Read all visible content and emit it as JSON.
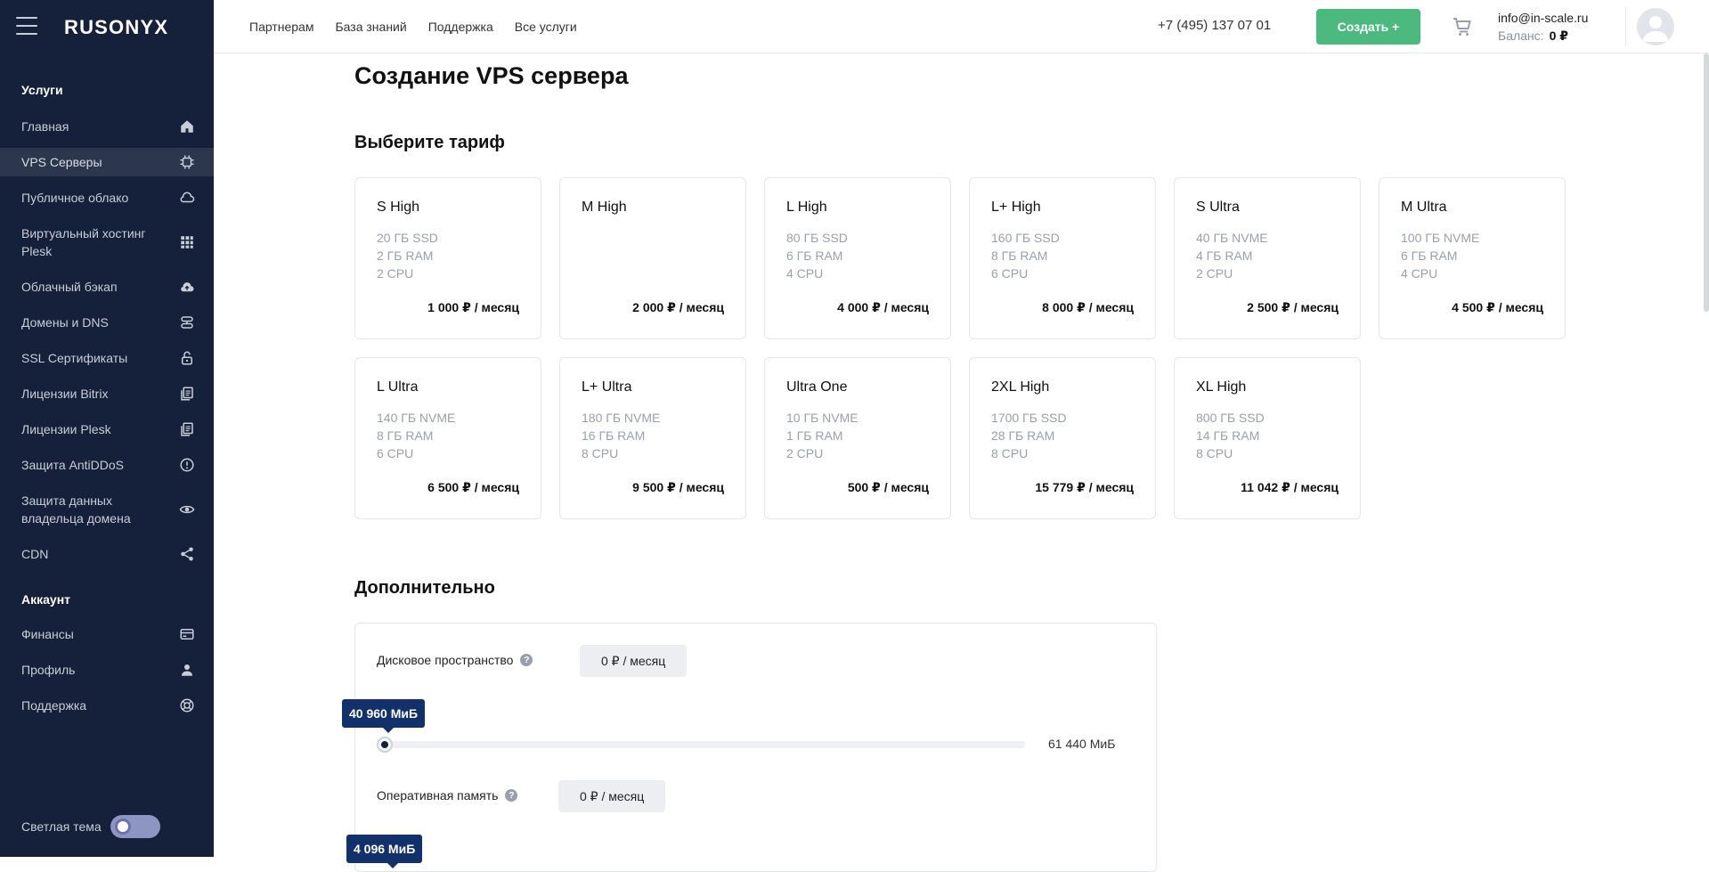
{
  "app": {
    "logo": "RUSONYX"
  },
  "sidebar": {
    "services_title": "Услуги",
    "items": [
      {
        "label": "Главная",
        "icon": "home-icon"
      },
      {
        "label": "VPS Серверы",
        "icon": "chip-icon",
        "active": true
      },
      {
        "label": "Публичное облако",
        "icon": "cloud-icon"
      },
      {
        "label": "Виртуальный хостинг Plesk",
        "icon": "grid-icon"
      },
      {
        "label": "Облачный бэкап",
        "icon": "cloud-upload-icon"
      },
      {
        "label": "Домены и DNS",
        "icon": "dns-icon"
      },
      {
        "label": "SSL Сертификаты",
        "icon": "lock-icon"
      },
      {
        "label": "Лицензии Bitrix",
        "icon": "license-icon"
      },
      {
        "label": "Лицензии Plesk",
        "icon": "license-icon"
      },
      {
        "label": "Защита AntiDDoS",
        "icon": "alert-icon"
      },
      {
        "label": "Защита данных владельца домена",
        "icon": "eye-icon"
      },
      {
        "label": "CDN",
        "icon": "share-icon"
      }
    ],
    "account_title": "Аккаунт",
    "account_items": [
      {
        "label": "Финансы",
        "icon": "card-icon"
      },
      {
        "label": "Профиль",
        "icon": "user-icon"
      },
      {
        "label": "Поддержка",
        "icon": "lifebuoy-icon"
      }
    ],
    "theme_label": "Светлая тема"
  },
  "topbar": {
    "nav": [
      "Партнерам",
      "База знаний",
      "Поддержка",
      "Все услуги"
    ],
    "phone": "+7 (495) 137 07 01",
    "create_label": "Создать +",
    "email": "info@in-scale.ru",
    "balance_label": "Баланс:",
    "balance_value": "0 ₽"
  },
  "main": {
    "title": "Создание VPS сервера",
    "tariff_title": "Выберите тариф",
    "tariffs": [
      {
        "name": "S High",
        "specs": [
          "20 ГБ SSD",
          "2 ГБ RAM",
          "2 CPU"
        ],
        "price": "1 000 ₽ / месяц"
      },
      {
        "name": "M High",
        "specs": [],
        "price": "2 000 ₽ / месяц"
      },
      {
        "name": "L High",
        "specs": [
          "80 ГБ SSD",
          "6 ГБ RAM",
          "4 CPU"
        ],
        "price": "4 000 ₽ / месяц"
      },
      {
        "name": "L+ High",
        "specs": [
          "160 ГБ SSD",
          "8 ГБ RAM",
          "6 CPU"
        ],
        "price": "8 000 ₽ / месяц"
      },
      {
        "name": "S Ultra",
        "specs": [
          "40 ГБ NVME",
          "4 ГБ RAM",
          "2 CPU"
        ],
        "price": "2 500 ₽ / месяц"
      },
      {
        "name": "M Ultra",
        "specs": [
          "100 ГБ NVME",
          "6 ГБ RAM",
          "4 CPU"
        ],
        "price": "4 500 ₽ / месяц"
      },
      {
        "name": "L Ultra",
        "specs": [
          "140 ГБ NVME",
          "8 ГБ RAM",
          "6 CPU"
        ],
        "price": "6 500 ₽ / месяц"
      },
      {
        "name": "L+ Ultra",
        "specs": [
          "180 ГБ NVME",
          "16 ГБ RAM",
          "8 CPU"
        ],
        "price": "9 500 ₽ / месяц"
      },
      {
        "name": "Ultra One",
        "specs": [
          "10 ГБ NVME",
          "1 ГБ RAM",
          "2 CPU"
        ],
        "price": "500 ₽ / месяц"
      },
      {
        "name": "2XL High",
        "specs": [
          "1700 ГБ SSD",
          "28 ГБ RAM",
          "8 CPU"
        ],
        "price": "15 779 ₽ / месяц"
      },
      {
        "name": "XL High",
        "specs": [
          "800 ГБ SSD",
          "14 ГБ RAM",
          "8 CPU"
        ],
        "price": "11 042 ₽ / месяц"
      }
    ],
    "extra_title": "Дополнительно",
    "disk": {
      "label": "Дисковое пространство",
      "price": "0 ₽  / месяц",
      "value": "40 960 МиБ",
      "max": "61 440 МиБ",
      "level": 0
    },
    "ram": {
      "label": "Оперативная память",
      "price": "0 ₽  / месяц",
      "value": "4 096 МиБ"
    }
  },
  "colors": {
    "sidebar_bg": "#15203a",
    "accent_green": "#4cba7e",
    "tooltip_navy": "#12306a"
  }
}
